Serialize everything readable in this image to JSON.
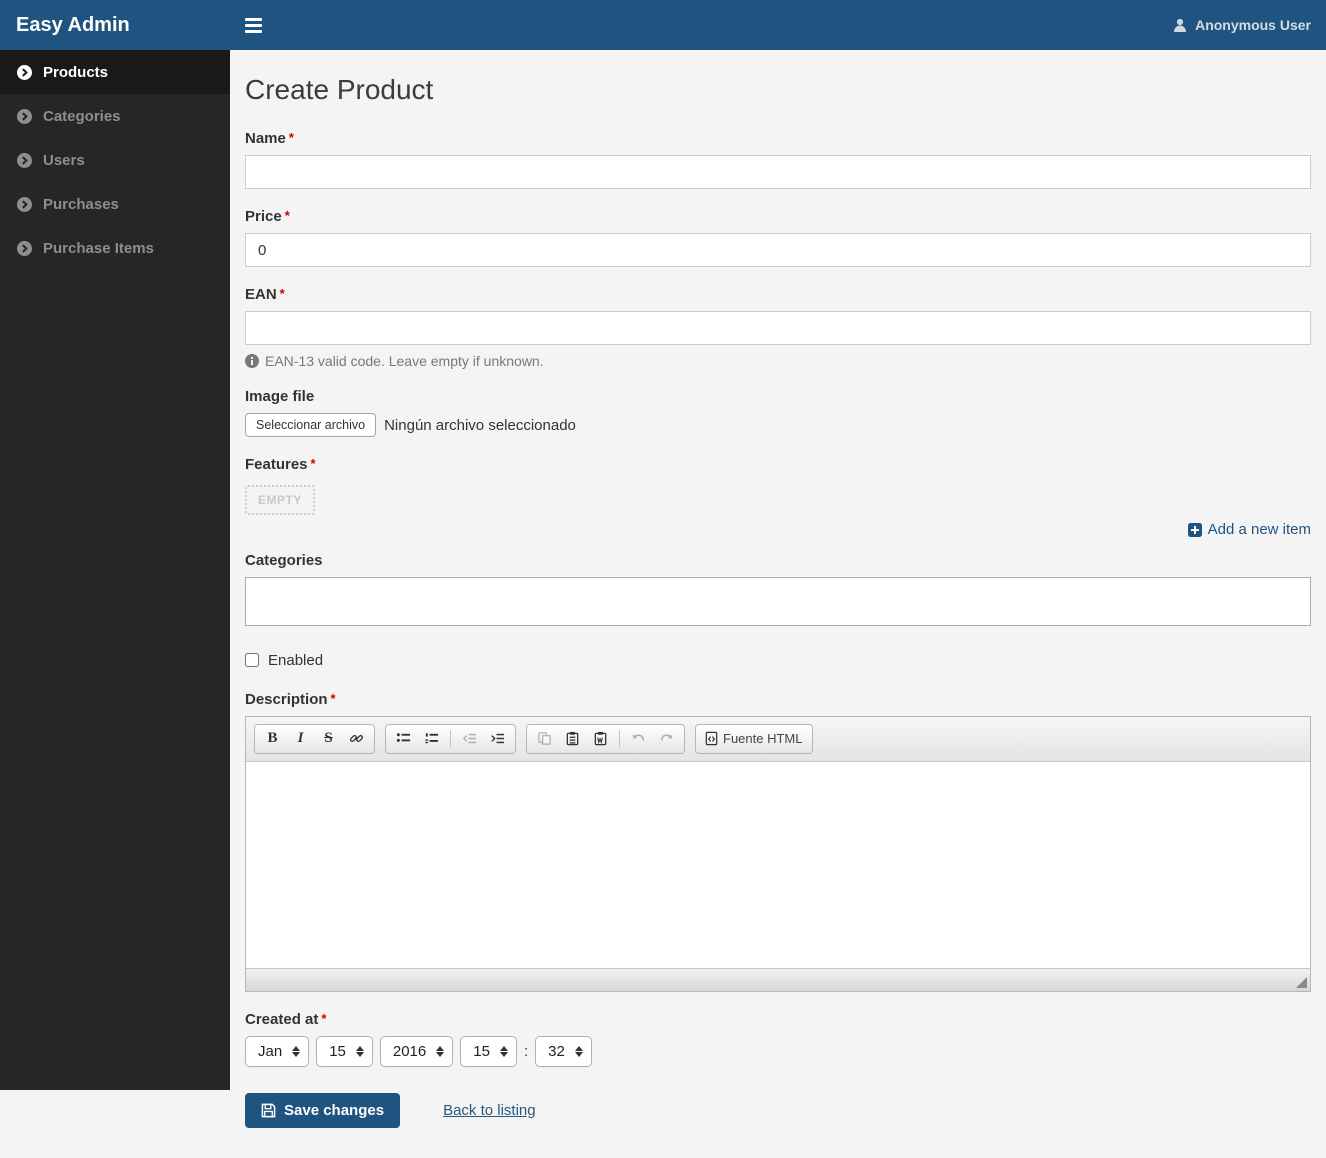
{
  "app": {
    "title": "Easy Admin",
    "user": "Anonymous User"
  },
  "sidebar": {
    "items": [
      {
        "label": "Products",
        "active": true
      },
      {
        "label": "Categories",
        "active": false
      },
      {
        "label": "Users",
        "active": false
      },
      {
        "label": "Purchases",
        "active": false
      },
      {
        "label": "Purchase Items",
        "active": false
      }
    ]
  },
  "page": {
    "title": "Create Product"
  },
  "form": {
    "name": {
      "label": "Name",
      "required": "*",
      "value": ""
    },
    "price": {
      "label": "Price",
      "required": "*",
      "value": "0"
    },
    "ean": {
      "label": "EAN",
      "required": "*",
      "value": "",
      "help": "EAN-13 valid code. Leave empty if unknown."
    },
    "image": {
      "label": "Image file",
      "button": "Seleccionar archivo",
      "status": "Ningún archivo seleccionado"
    },
    "features": {
      "label": "Features",
      "required": "*",
      "empty_badge": "EMPTY",
      "add_link": "Add a new item"
    },
    "categories": {
      "label": "Categories"
    },
    "enabled": {
      "label": "Enabled",
      "checked": false
    },
    "description": {
      "label": "Description",
      "required": "*",
      "toolbar": {
        "bold": "B",
        "italic": "I",
        "strike": "S",
        "source_button": "Fuente HTML"
      }
    },
    "created_at": {
      "label": "Created at",
      "required": "*",
      "month": "Jan",
      "day": "15",
      "year": "2016",
      "hour": "15",
      "minute": "32",
      "separator": ":"
    }
  },
  "actions": {
    "save": "Save changes",
    "back": "Back to listing"
  },
  "colors": {
    "brand": "#1f5480",
    "sidebar_bg": "#262626",
    "sidebar_active_bg": "#191919",
    "page_bg": "#f4f4f4",
    "required_asterisk": "#cc0000"
  }
}
